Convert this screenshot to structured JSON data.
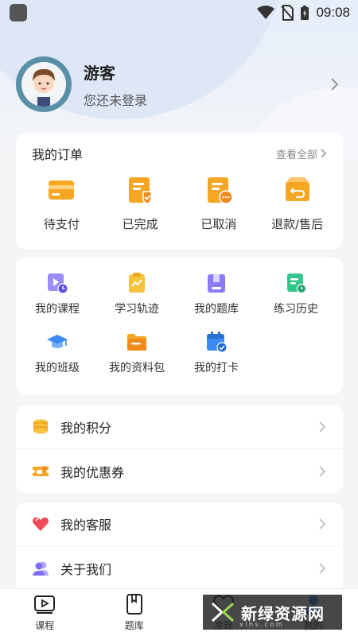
{
  "status_bar": {
    "time": "09:08",
    "icons": [
      "wifi-icon",
      "no-sim-icon",
      "battery-charging-icon"
    ]
  },
  "profile": {
    "name": "游客",
    "subtitle": "您还未登录"
  },
  "orders": {
    "title": "我的订单",
    "view_all": "查看全部",
    "items": [
      {
        "label": "待支付",
        "icon": "card-wallet-icon"
      },
      {
        "label": "已完成",
        "icon": "order-done-icon"
      },
      {
        "label": "已取消",
        "icon": "order-cancel-icon"
      },
      {
        "label": "退款/售后",
        "icon": "refund-box-icon"
      }
    ]
  },
  "tools": {
    "items": [
      {
        "label": "我的课程",
        "icon": "course-play-icon"
      },
      {
        "label": "学习轨迹",
        "icon": "study-trace-icon"
      },
      {
        "label": "我的题库",
        "icon": "question-bank-icon"
      },
      {
        "label": "练习历史",
        "icon": "practice-history-icon"
      },
      {
        "label": "我的班级",
        "icon": "graduation-cap-icon"
      },
      {
        "label": "我的资料包",
        "icon": "folder-icon"
      },
      {
        "label": "我的打卡",
        "icon": "calendar-check-icon"
      }
    ]
  },
  "points": {
    "items": [
      {
        "label": "我的积分",
        "icon": "coins-icon"
      },
      {
        "label": "我的优惠券",
        "icon": "coupon-icon"
      }
    ]
  },
  "service": {
    "items": [
      {
        "label": "我的客服",
        "icon": "heart-icon"
      },
      {
        "label": "关于我们",
        "icon": "users-icon"
      }
    ]
  },
  "tabbar": {
    "items": [
      {
        "label": "课程",
        "icon": "video-tab-icon"
      },
      {
        "label": "题库",
        "icon": "book-tab-icon"
      },
      {
        "label": "发现",
        "icon": "heart-tab-icon"
      },
      {
        "label": "我的",
        "icon": "profile-tab-icon"
      }
    ]
  },
  "watermark": {
    "text": "新绿资源网",
    "sub": "x l h s . c o m"
  },
  "colors": {
    "accent_orange": "#f5a623",
    "purple": "#7b6cf6",
    "green": "#34c58a",
    "blue": "#3a8bf5",
    "red": "#ef4b5a"
  }
}
